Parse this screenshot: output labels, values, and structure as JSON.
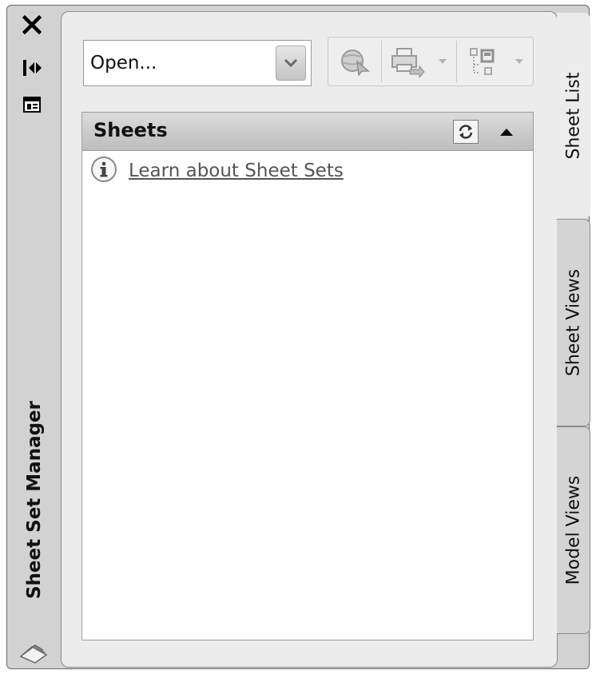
{
  "palette": {
    "title": "Sheet Set Manager",
    "icons": {
      "close": "close-icon",
      "autohide": "autohide-icon",
      "properties": "properties-icon",
      "sheet_set": "sheet-set-icon"
    }
  },
  "open_select": {
    "value": "Open...",
    "arrow_icon": "chevron-down-icon"
  },
  "toolbar": {
    "buttons": [
      {
        "name": "publish-to-web",
        "icon": "globe-publish-icon",
        "enabled": false
      },
      {
        "name": "publish",
        "icon": "printer-publish-icon",
        "enabled": false,
        "has_dropdown": true
      },
      {
        "name": "sheet-selections",
        "icon": "sheet-selection-icon",
        "enabled": false,
        "has_dropdown": true
      }
    ]
  },
  "sheets_panel": {
    "title": "Sheets",
    "refresh_icon": "refresh-icon",
    "collapse_icon": "collapse-up-icon",
    "info_icon": "info-icon",
    "link_text": "Learn about Sheet Sets"
  },
  "tabs": [
    {
      "label": "Sheet List",
      "active": true
    },
    {
      "label": "Sheet Views",
      "active": false
    },
    {
      "label": "Model Views",
      "active": false
    }
  ],
  "colors": {
    "panel_bg": "#ececec",
    "frame_bg": "#d2d2d2",
    "header_bg": "#c8c8c8"
  }
}
